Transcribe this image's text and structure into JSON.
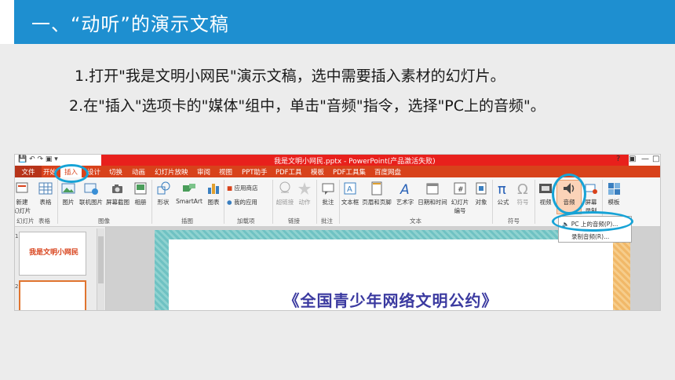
{
  "header": {
    "title": "一、“动听”的演示文稿",
    "color": "#1e8fd0"
  },
  "steps": [
    "1.打开\"我是文明小网民\"演示文稿，选中需要插入素材的幻灯片。",
    "2.在\"插入\"选项卡的\"媒体\"组中，单击\"音频\"指令，选择\"PC上的音频\"。"
  ],
  "ppt": {
    "window_title": "我是文明小网民.pptx - PowerPoint(产品激活失败)",
    "window_controls": [
      "?",
      "▣",
      "—",
      "□"
    ],
    "tabs": [
      "文件",
      "开始",
      "插入",
      "设计",
      "切换",
      "动画",
      "幻灯片放映",
      "审阅",
      "视图",
      "PPT助手",
      "PDF工具",
      "模板",
      "PDF工具集",
      "百度网盘"
    ],
    "active_tab": "插入",
    "ribbon_buttons": {
      "new_slide": "新建\n幻灯片",
      "table": "表格",
      "picture": "图片",
      "online_picture": "联机图片",
      "screenshot": "屏幕截图",
      "album": "相册",
      "shapes": "形状",
      "smartart": "SmartArt",
      "chart": "图表",
      "store": "应用商店",
      "my_apps": "我的应用",
      "hyperlink": "超链接",
      "action": "动作",
      "comment": "批注",
      "textbox": "文本框",
      "header_footer": "页眉和页脚",
      "wordart": "艺术字",
      "datetime": "日期和时间",
      "slide_number": "幻灯片\n编号",
      "object": "对象",
      "equation": "公式",
      "symbol": "符号",
      "video": "视频",
      "audio": "音频",
      "screen_record": "屏幕\n录制",
      "template": "模板"
    },
    "groups": [
      "幻灯片",
      "表格",
      "图像",
      "插图",
      "加载项",
      "链接",
      "批注",
      "文本",
      "符号"
    ],
    "audio_menu": [
      "PC 上的音频(P)...",
      "录制音频(R)..."
    ],
    "slide_title": "《全国青少年网络文明公约》",
    "thumb_text": "我是文明小网民",
    "thumb_numbers": [
      "1",
      "2"
    ]
  }
}
